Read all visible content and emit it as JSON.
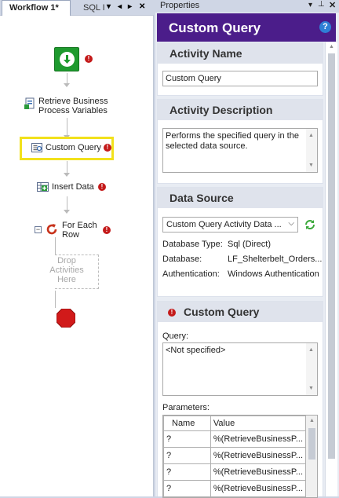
{
  "designer": {
    "tabs": [
      {
        "label": "Workflow 1*",
        "active": true
      },
      {
        "label": "SQL I",
        "active": false
      }
    ],
    "tab_controls": [
      "▾",
      "◂",
      "▸",
      "✕"
    ],
    "nodes": [
      {
        "label": "Retrieve Business Process Variables",
        "line1": "Retrieve Business",
        "line2": "Process Variables"
      },
      {
        "label": "Custom Query",
        "selected": true
      },
      {
        "label": "Insert Data"
      },
      {
        "label": "For Each Row",
        "line1": "For Each",
        "line2": "Row"
      }
    ],
    "drop_zone": {
      "line1": "Drop",
      "line2": "Activities",
      "line3": "Here"
    },
    "error_mark": "!",
    "collapse_symbol": "−"
  },
  "properties": {
    "panel_title": "Properties",
    "header_title": "Custom Query",
    "help_glyph": "?",
    "activity_name": {
      "title": "Activity Name",
      "value": "Custom Query"
    },
    "activity_description": {
      "title": "Activity Description",
      "value": "Performs the specified query in the selected data source."
    },
    "data_source": {
      "title": "Data Source",
      "selected": "Custom Query Activity Data ...",
      "info": [
        {
          "label": "Database Type:",
          "value": "Sql (Direct)"
        },
        {
          "label": "Database:",
          "value": "LF_Shelterbelt_Orders..."
        },
        {
          "label": "Authentication:",
          "value": "Windows Authentication"
        }
      ]
    },
    "custom_query": {
      "title": "Custom Query",
      "query_label": "Query:",
      "query_value": "<Not specified>",
      "parameters_label": "Parameters:",
      "columns": [
        "Name",
        "Value"
      ],
      "rows": [
        {
          "name": "?",
          "value": "%(RetrieveBusinessP..."
        },
        {
          "name": "?",
          "value": "%(RetrieveBusinessP..."
        },
        {
          "name": "?",
          "value": "%(RetrieveBusinessP..."
        },
        {
          "name": "?",
          "value": "%(RetrieveBusinessP..."
        }
      ]
    }
  },
  "colors": {
    "header_purple": "#4b1d8a",
    "selection_yellow": "#f2e11c",
    "start_green": "#1e9a2e",
    "stop_red": "#d11a1a",
    "error_red": "#c41a1a",
    "refresh_green": "#3aa83a",
    "help_blue": "#2f7fd6"
  },
  "icons": [
    "start-icon",
    "variables-icon",
    "query-icon",
    "insert-data-icon",
    "for-each-icon",
    "stop-icon",
    "error-icon",
    "help-icon",
    "refresh-icon",
    "dropdown-chevron-icon",
    "pin-icon",
    "close-icon"
  ]
}
